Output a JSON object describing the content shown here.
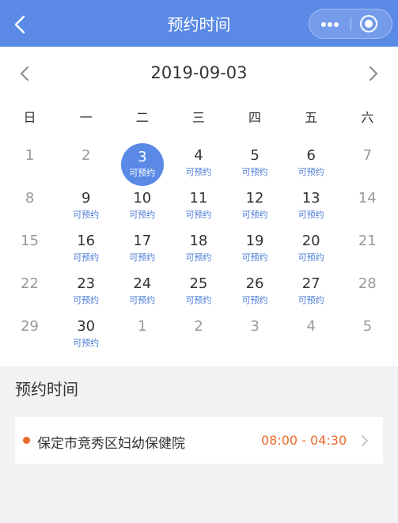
{
  "header": {
    "title": "预约时间",
    "back_icon": "chevron-left-icon",
    "more_icon": "more-dots-icon",
    "close_icon": "target-circle-icon"
  },
  "calendar": {
    "current_date": "2019-09-03",
    "weekdays": [
      "日",
      "一",
      "二",
      "三",
      "四",
      "五",
      "六"
    ],
    "days": [
      {
        "num": "1",
        "sub": "",
        "dim": true,
        "selected": false
      },
      {
        "num": "2",
        "sub": "",
        "dim": true,
        "selected": false
      },
      {
        "num": "3",
        "sub": "可预约",
        "dim": false,
        "selected": true
      },
      {
        "num": "4",
        "sub": "可预约",
        "dim": false,
        "selected": false
      },
      {
        "num": "5",
        "sub": "可预约",
        "dim": false,
        "selected": false
      },
      {
        "num": "6",
        "sub": "可预约",
        "dim": false,
        "selected": false
      },
      {
        "num": "7",
        "sub": "",
        "dim": true,
        "selected": false
      },
      {
        "num": "8",
        "sub": "",
        "dim": true,
        "selected": false
      },
      {
        "num": "9",
        "sub": "可预约",
        "dim": false,
        "selected": false
      },
      {
        "num": "10",
        "sub": "可预约",
        "dim": false,
        "selected": false
      },
      {
        "num": "11",
        "sub": "可预约",
        "dim": false,
        "selected": false
      },
      {
        "num": "12",
        "sub": "可预约",
        "dim": false,
        "selected": false
      },
      {
        "num": "13",
        "sub": "可预约",
        "dim": false,
        "selected": false
      },
      {
        "num": "14",
        "sub": "",
        "dim": true,
        "selected": false
      },
      {
        "num": "15",
        "sub": "",
        "dim": true,
        "selected": false
      },
      {
        "num": "16",
        "sub": "可预约",
        "dim": false,
        "selected": false
      },
      {
        "num": "17",
        "sub": "可预约",
        "dim": false,
        "selected": false
      },
      {
        "num": "18",
        "sub": "可预约",
        "dim": false,
        "selected": false
      },
      {
        "num": "19",
        "sub": "可预约",
        "dim": false,
        "selected": false
      },
      {
        "num": "20",
        "sub": "可预约",
        "dim": false,
        "selected": false
      },
      {
        "num": "21",
        "sub": "",
        "dim": true,
        "selected": false
      },
      {
        "num": "22",
        "sub": "",
        "dim": true,
        "selected": false
      },
      {
        "num": "23",
        "sub": "可预约",
        "dim": false,
        "selected": false
      },
      {
        "num": "24",
        "sub": "可预约",
        "dim": false,
        "selected": false
      },
      {
        "num": "25",
        "sub": "可预约",
        "dim": false,
        "selected": false
      },
      {
        "num": "26",
        "sub": "可预约",
        "dim": false,
        "selected": false
      },
      {
        "num": "27",
        "sub": "可预约",
        "dim": false,
        "selected": false
      },
      {
        "num": "28",
        "sub": "",
        "dim": true,
        "selected": false
      },
      {
        "num": "29",
        "sub": "",
        "dim": true,
        "selected": false
      },
      {
        "num": "30",
        "sub": "可预约",
        "dim": false,
        "selected": false
      },
      {
        "num": "1",
        "sub": "",
        "dim": true,
        "selected": false
      },
      {
        "num": "2",
        "sub": "",
        "dim": true,
        "selected": false
      },
      {
        "num": "3",
        "sub": "",
        "dim": true,
        "selected": false
      },
      {
        "num": "4",
        "sub": "",
        "dim": true,
        "selected": false
      },
      {
        "num": "5",
        "sub": "",
        "dim": true,
        "selected": false
      }
    ]
  },
  "appointment_section": {
    "title": "预约时间",
    "hospital": "保定市竞秀区妇幼保健院",
    "time": "08:00 - 04:30"
  },
  "colors": {
    "header_bg": "#5a8ae6",
    "accent": "#5a8ae6",
    "available_text": "#4a7bd6",
    "time_orange": "#ea6a2b",
    "page_bg": "#f2f2f4"
  }
}
